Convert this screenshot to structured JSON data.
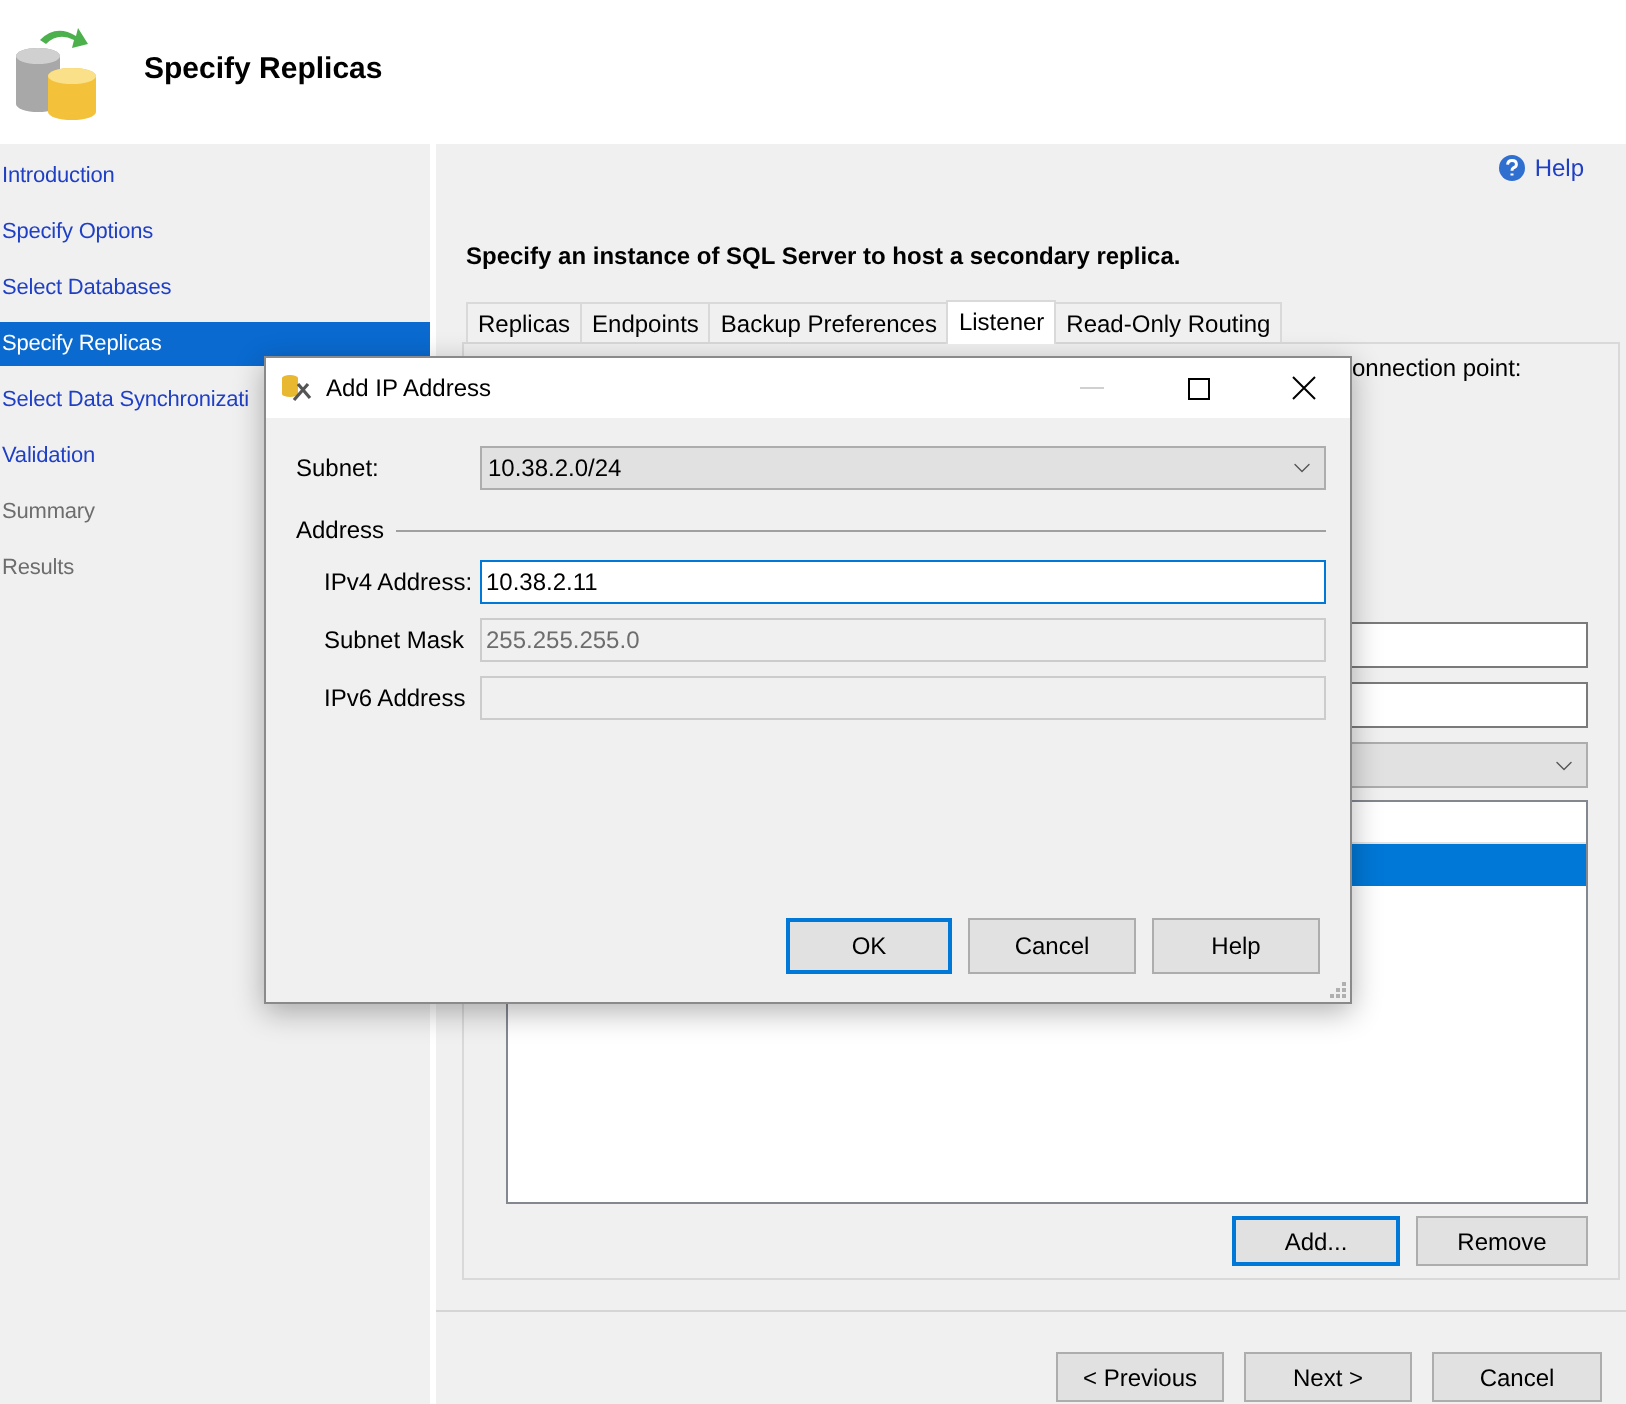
{
  "header": {
    "title": "Specify Replicas"
  },
  "sidebar": {
    "items": [
      {
        "label": "Introduction",
        "selected": false,
        "disabled": false
      },
      {
        "label": "Specify Options",
        "selected": false,
        "disabled": false
      },
      {
        "label": "Select Databases",
        "selected": false,
        "disabled": false
      },
      {
        "label": "Specify Replicas",
        "selected": true,
        "disabled": false
      },
      {
        "label": "Select Data Synchronizati",
        "selected": false,
        "disabled": false
      },
      {
        "label": "Validation",
        "selected": false,
        "disabled": false
      },
      {
        "label": "Summary",
        "selected": false,
        "disabled": true
      },
      {
        "label": "Results",
        "selected": false,
        "disabled": true
      }
    ]
  },
  "help_link": "Help",
  "instruction": "Specify an instance of SQL Server to host a secondary replica.",
  "tabs": [
    {
      "label": "Replicas",
      "selected": false
    },
    {
      "label": "Endpoints",
      "selected": false
    },
    {
      "label": "Backup Preferences",
      "selected": false
    },
    {
      "label": "Listener",
      "selected": true
    },
    {
      "label": "Read-Only Routing",
      "selected": false
    }
  ],
  "listener_panel": {
    "partial_text": "onnection point:",
    "ip_list_rows": [
      {
        "selected": false
      },
      {
        "selected": true
      }
    ],
    "buttons": [
      {
        "label": "Add...",
        "default": true
      },
      {
        "label": "Remove",
        "default": false
      }
    ]
  },
  "dialog": {
    "title": "Add IP Address",
    "minimize_disabled": true,
    "subnet": {
      "label": "Subnet:",
      "value": "10.38.2.0/24"
    },
    "group_label": "Address",
    "fields": [
      {
        "label": "IPv4 Address:",
        "value": "10.38.2.11",
        "focused": true,
        "disabled": false
      },
      {
        "label": "Subnet Mask",
        "value": "255.255.255.0",
        "focused": false,
        "disabled": true
      },
      {
        "label": "IPv6 Address",
        "focused": false,
        "disabled": true
      }
    ],
    "buttons": [
      {
        "label": "OK",
        "default": true
      },
      {
        "label": "Cancel",
        "default": false
      },
      {
        "label": "Help",
        "default": false
      }
    ]
  },
  "nav_buttons": [
    "< Previous",
    "Next >",
    "Cancel"
  ]
}
